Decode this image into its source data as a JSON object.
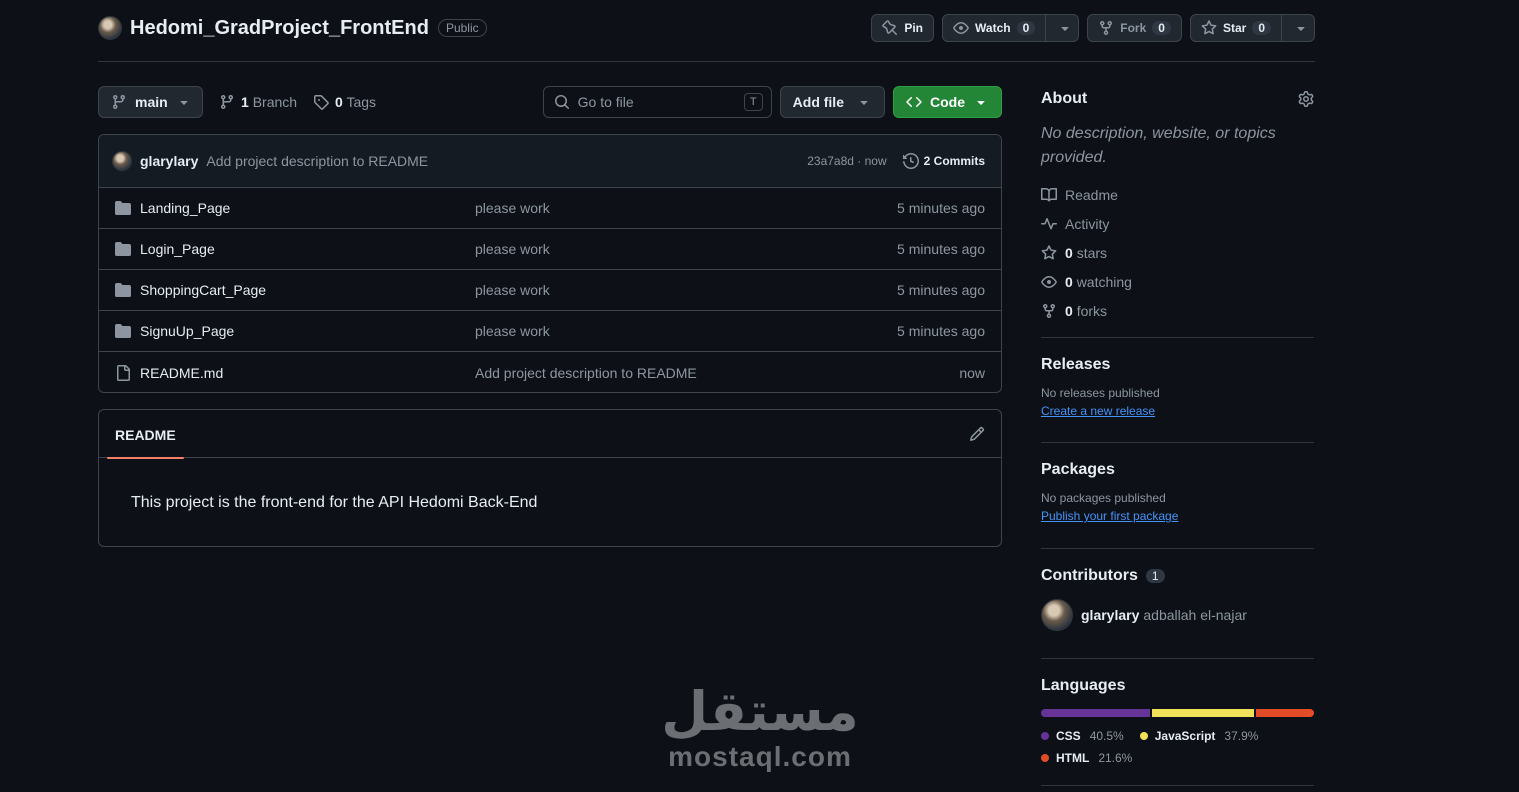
{
  "repo": {
    "name": "Hedomi_GradProject_FrontEnd",
    "visibility": "Public",
    "pin_label": "Pin",
    "watch_label": "Watch",
    "watch_count": "0",
    "fork_label": "Fork",
    "fork_count": "0",
    "star_label": "Star",
    "star_count": "0"
  },
  "toolbar": {
    "branch": "main",
    "branch_count": "1",
    "branch_label": "Branch",
    "tag_count": "0",
    "tag_label": "Tags",
    "search_placeholder": "Go to file",
    "search_shortcut": "T",
    "add_file_label": "Add file",
    "code_label": "Code"
  },
  "latest_commit": {
    "user": "glarylary",
    "message": "Add project description to README",
    "hash_time": "23a7a8d · now",
    "commits_label": "2 Commits"
  },
  "files": [
    {
      "type": "folder",
      "name": "Landing_Page",
      "message": "please work",
      "time": "5 minutes ago"
    },
    {
      "type": "folder",
      "name": "Login_Page",
      "message": "please work",
      "time": "5 minutes ago"
    },
    {
      "type": "folder",
      "name": "ShoppingCart_Page",
      "message": "please work",
      "time": "5 minutes ago"
    },
    {
      "type": "folder",
      "name": "SignuUp_Page",
      "message": "please work",
      "time": "5 minutes ago"
    },
    {
      "type": "file",
      "name": "README.md",
      "message": "Add project description to README",
      "time": "now"
    }
  ],
  "readme": {
    "tab_label": "README",
    "content": "This project is the front-end for the API Hedomi Back-End"
  },
  "about": {
    "title": "About",
    "description": "No description, website, or topics provided.",
    "readme_label": "Readme",
    "activity_label": "Activity",
    "stars_count": "0",
    "stars_label": "stars",
    "watching_count": "0",
    "watching_label": "watching",
    "forks_count": "0",
    "forks_label": "forks"
  },
  "releases": {
    "title": "Releases",
    "empty_text": "No releases published",
    "link": "Create a new release"
  },
  "packages": {
    "title": "Packages",
    "empty_text": "No packages published",
    "link": "Publish your first package"
  },
  "contributors": {
    "title": "Contributors",
    "count": "1",
    "items": [
      {
        "login": "glarylary",
        "full_name": "adballah el-najar"
      }
    ]
  },
  "languages": {
    "title": "Languages",
    "items": [
      {
        "name": "CSS",
        "percent_label": "40.5%",
        "percent": 40.5,
        "color": "#663399"
      },
      {
        "name": "JavaScript",
        "percent_label": "37.9%",
        "percent": 37.9,
        "color": "#f1e05a"
      },
      {
        "name": "HTML",
        "percent_label": "21.6%",
        "percent": 21.6,
        "color": "#e34c26"
      }
    ]
  },
  "watermark": {
    "arabic": "مستقل",
    "latin": "mostaql.com"
  }
}
